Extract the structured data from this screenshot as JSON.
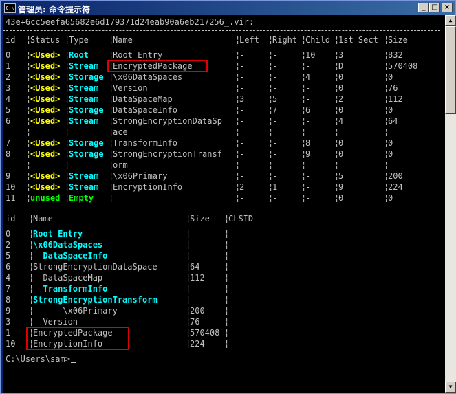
{
  "window": {
    "title": "管理员: 命令提示符",
    "app_icon": "C:\\",
    "buttons": {
      "minimize": "_",
      "maximize": "□",
      "close": "×"
    }
  },
  "console": {
    "file_line": "43e+6cc5eefa65682e6d179371d24eab90a6eb217256_.vir:",
    "table1": {
      "headers": [
        "id",
        "Status",
        "Type",
        "Name",
        "Left",
        "Right",
        "Child",
        "1st Sect",
        "Size"
      ],
      "rows": [
        {
          "id": "0",
          "status": "<Used>",
          "type": "Root",
          "name": "Root Entry",
          "left": "-",
          "right": "-",
          "child": "10",
          "sect": "3",
          "size": "832"
        },
        {
          "id": "1",
          "status": "<Used>",
          "type": "Stream",
          "name": "EncryptedPackage",
          "left": "-",
          "right": "-",
          "child": "-",
          "sect": "D",
          "size": "570408"
        },
        {
          "id": "2",
          "status": "<Used>",
          "type": "Storage",
          "name": "\\x06DataSpaces",
          "left": "-",
          "right": "-",
          "child": "4",
          "sect": "0",
          "size": "0"
        },
        {
          "id": "3",
          "status": "<Used>",
          "type": "Stream",
          "name": "Version",
          "left": "-",
          "right": "-",
          "child": "-",
          "sect": "0",
          "size": "76"
        },
        {
          "id": "4",
          "status": "<Used>",
          "type": "Stream",
          "name": "DataSpaceMap",
          "left": "3",
          "right": "5",
          "child": "-",
          "sect": "2",
          "size": "112"
        },
        {
          "id": "5",
          "status": "<Used>",
          "type": "Storage",
          "name": "DataSpaceInfo",
          "left": "-",
          "right": "7",
          "child": "6",
          "sect": "0",
          "size": "0"
        },
        {
          "id": "6",
          "status": "<Used>",
          "type": "Stream",
          "name": "StrongEncryptionDataSp",
          "left": "-",
          "right": "-",
          "child": "-",
          "sect": "4",
          "size": "64"
        },
        {
          "id": "",
          "status": "",
          "type": "",
          "name": "ace",
          "left": "",
          "right": "",
          "child": "",
          "sect": "",
          "size": ""
        },
        {
          "id": "7",
          "status": "<Used>",
          "type": "Storage",
          "name": "TransformInfo",
          "left": "-",
          "right": "-",
          "child": "8",
          "sect": "0",
          "size": "0"
        },
        {
          "id": "8",
          "status": "<Used>",
          "type": "Storage",
          "name": "StrongEncryptionTransf",
          "left": "-",
          "right": "-",
          "child": "9",
          "sect": "0",
          "size": "0"
        },
        {
          "id": "",
          "status": "",
          "type": "",
          "name": "orm",
          "left": "",
          "right": "",
          "child": "",
          "sect": "",
          "size": ""
        },
        {
          "id": "9",
          "status": "<Used>",
          "type": "Stream",
          "name": "\\x06Primary",
          "left": "-",
          "right": "-",
          "child": "-",
          "sect": "5",
          "size": "200"
        },
        {
          "id": "10",
          "status": "<Used>",
          "type": "Stream",
          "name": "EncryptionInfo",
          "left": "2",
          "right": "1",
          "child": "-",
          "sect": "9",
          "size": "224"
        },
        {
          "id": "11",
          "status": "unused",
          "type": "Empty",
          "name": "",
          "left": "-",
          "right": "-",
          "child": "-",
          "sect": "0",
          "size": "0"
        }
      ]
    },
    "table2": {
      "headers": [
        "id",
        "Name",
        "Size",
        "CLSID"
      ],
      "rows": [
        {
          "id": "0",
          "name": "Root Entry",
          "size": "-",
          "style": "cyan"
        },
        {
          "id": "2",
          "name": "\\x06DataSpaces",
          "size": "-",
          "style": "cyan"
        },
        {
          "id": "5",
          "name": "  DataSpaceInfo",
          "size": "-",
          "style": "cyan"
        },
        {
          "id": "6",
          "name": "StrongEncryptionDataSpace",
          "size": "64",
          "style": "plain"
        },
        {
          "id": "4",
          "name": "  DataSpaceMap",
          "size": "112",
          "style": "plain"
        },
        {
          "id": "7",
          "name": "  TransformInfo",
          "size": "-",
          "style": "cyan"
        },
        {
          "id": "8",
          "name": "StrongEncryptionTransform",
          "size": "-",
          "style": "cyan"
        },
        {
          "id": "9",
          "name": "      \\x06Primary",
          "size": "200",
          "style": "plain"
        },
        {
          "id": "3",
          "name": "  Version",
          "size": "76",
          "style": "plain"
        },
        {
          "id": "1",
          "name": "EncryptedPackage",
          "size": "570408",
          "style": "plain"
        },
        {
          "id": "10",
          "name": "EncryptionInfo",
          "size": "224",
          "style": "plain"
        }
      ]
    },
    "prompt": "C:\\Users\\sam>"
  },
  "colors": {
    "background": "#000000",
    "text": "#c0c0c0",
    "used": "#ffff00",
    "storage": "#00ffff",
    "unused": "#00ff00",
    "highlight_box": "#e00000"
  }
}
